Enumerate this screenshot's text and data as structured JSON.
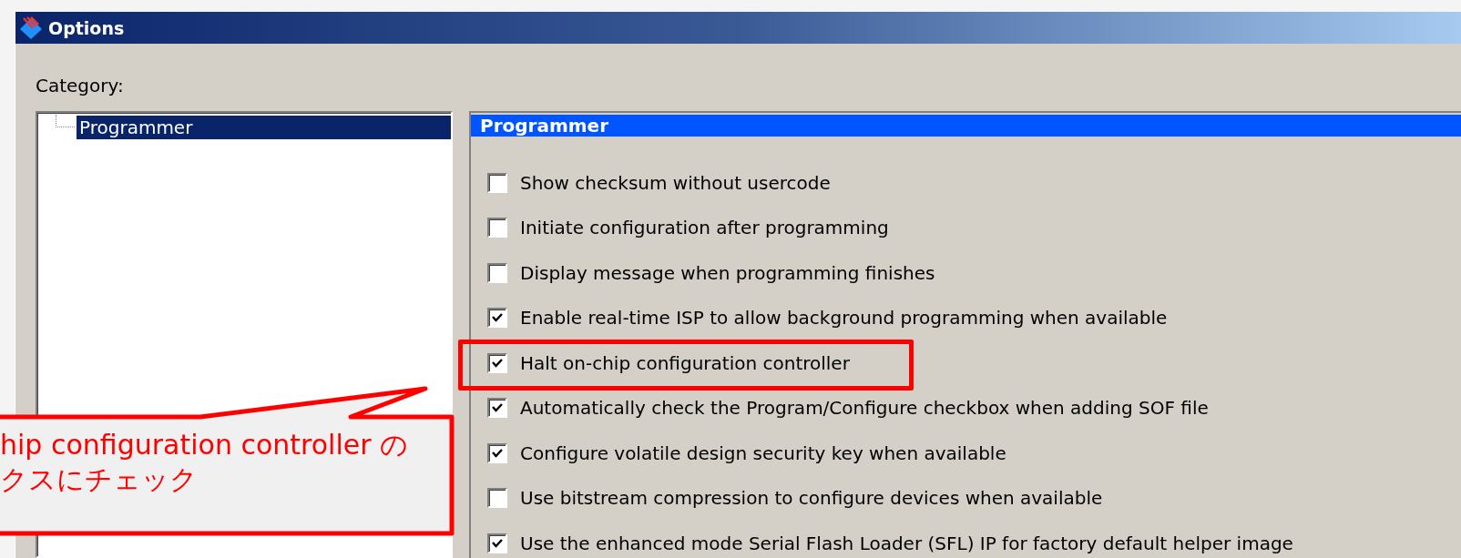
{
  "window": {
    "title": "Options"
  },
  "category_label": "Category:",
  "tree": {
    "items": [
      {
        "label": "Programmer",
        "selected": true
      }
    ]
  },
  "panel": {
    "title": "Programmer",
    "options": [
      {
        "label": "Show checksum without usercode",
        "checked": false
      },
      {
        "label": "Initiate configuration after programming",
        "checked": false
      },
      {
        "label": "Display message when programming finishes",
        "checked": false
      },
      {
        "label": "Enable real-time ISP to allow background programming when available",
        "checked": true
      },
      {
        "label": "Halt on-chip configuration controller",
        "checked": true,
        "highlighted": true
      },
      {
        "label": "Automatically check the Program/Configure checkbox when adding SOF file",
        "checked": true
      },
      {
        "label": "Configure volatile design security key when available",
        "checked": true
      },
      {
        "label": "Use bitstream compression to configure devices when available",
        "checked": false
      },
      {
        "label": "Use the enhanced mode Serial Flash Loader (SFL) IP for factory default helper image",
        "checked": true
      }
    ]
  },
  "callout": {
    "lines": [
      "hip configuration controller の",
      "クスにチェック"
    ]
  }
}
